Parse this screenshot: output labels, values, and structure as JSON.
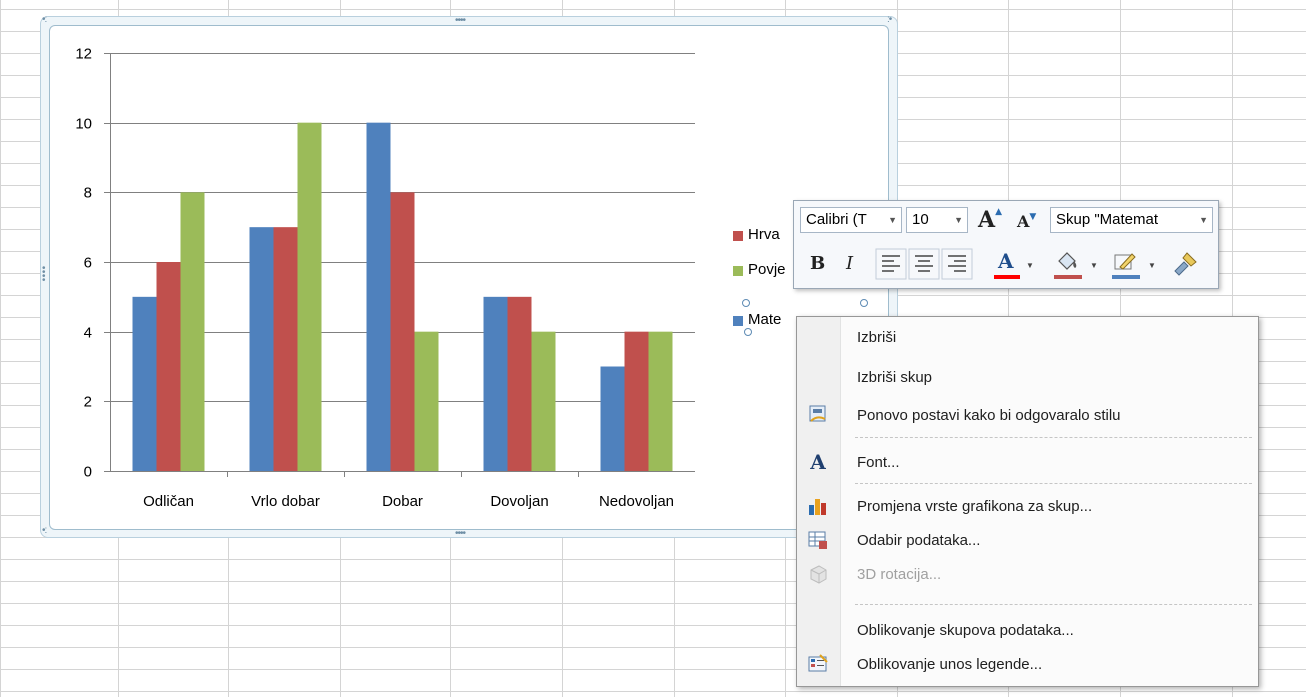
{
  "chart_data": {
    "type": "bar",
    "categories": [
      "Odličan",
      "Vrlo dobar",
      "Dobar",
      "Dovoljan",
      "Nedovoljan"
    ],
    "series": [
      {
        "name": "Matematika",
        "color": "#4f81bd",
        "values": [
          5,
          7,
          10,
          5,
          3
        ]
      },
      {
        "name": "Hrvatski",
        "color": "#c0504d",
        "values": [
          6,
          7,
          8,
          5,
          4
        ]
      },
      {
        "name": "Povijest",
        "color": "#9bbb59",
        "values": [
          8,
          10,
          4,
          4,
          4
        ]
      }
    ],
    "yticks": [
      "0",
      "2",
      "4",
      "6",
      "8",
      "10",
      "12"
    ],
    "ylim": [
      0,
      12
    ],
    "grid": true,
    "legend": {
      "position": "right",
      "visible_labels": [
        "Hrva",
        "Povje",
        "Mate"
      ]
    }
  },
  "mini_toolbar": {
    "font_name": "Calibri (T",
    "font_size": "10",
    "grow_font": "A",
    "shrink_font": "A",
    "series_select": "Skup \"Matemat",
    "bold": "B",
    "italic": "I",
    "font_color_label": "A",
    "font_color": "#ff0000",
    "fill_color": "#c0504d",
    "outline_color": "#4f81bd"
  },
  "context_menu": {
    "items": [
      {
        "label": "Izbriši",
        "icon": "none",
        "enabled": true
      },
      {
        "label": "Izbriši skup",
        "icon": "none",
        "enabled": true
      },
      {
        "label": "Ponovo postavi kako bi odgovaralo stilu",
        "icon": "reset-style-icon",
        "enabled": true
      },
      {
        "label": "Font...",
        "icon": "font-icon",
        "enabled": true
      },
      {
        "label": "Promjena vrste grafikona za skup...",
        "icon": "chart-type-icon",
        "enabled": true
      },
      {
        "label": "Odabir podataka...",
        "icon": "select-data-icon",
        "enabled": true
      },
      {
        "label": "3D rotacija...",
        "icon": "rotation-3d-icon",
        "enabled": false
      },
      {
        "label": "Oblikovanje skupova podataka...",
        "icon": "none",
        "enabled": true
      },
      {
        "label": "Oblikovanje unos legende...",
        "icon": "format-legend-icon",
        "enabled": true
      }
    ],
    "font_icon_glyph": "A"
  }
}
